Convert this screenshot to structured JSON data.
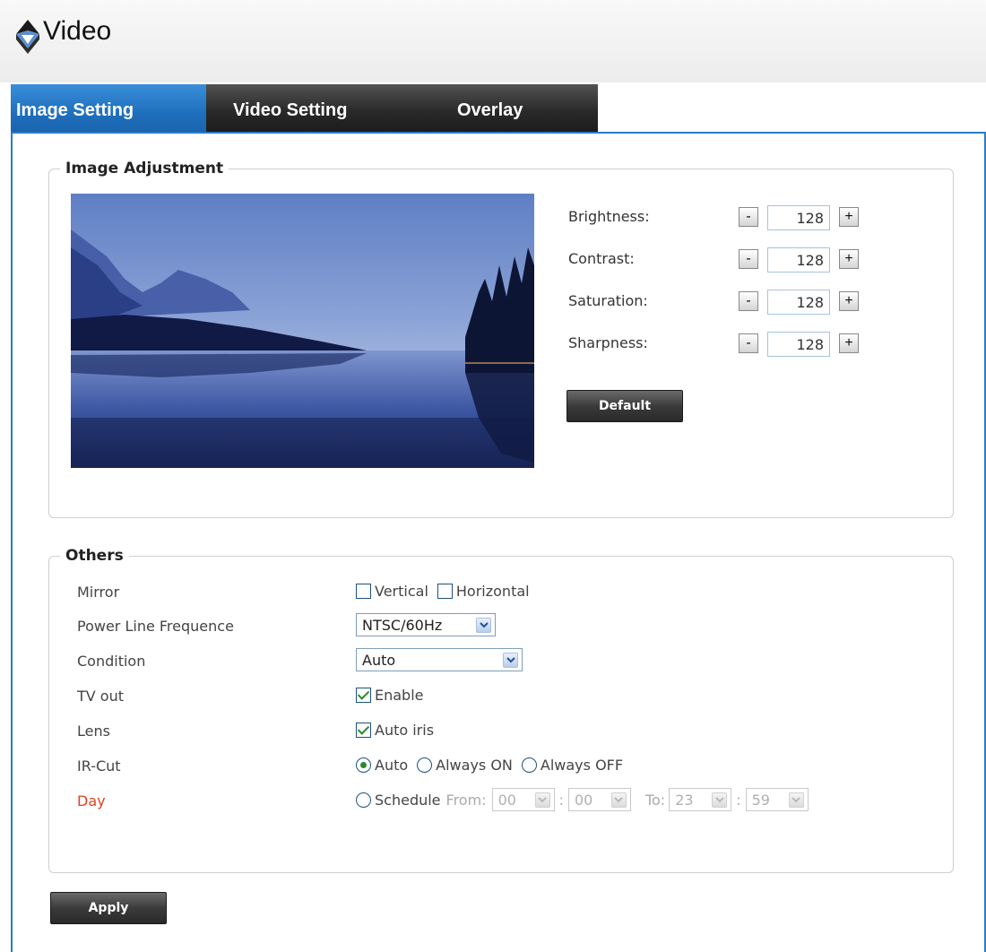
{
  "header": {
    "title": "Video"
  },
  "tabs": [
    {
      "label": "Image Setting",
      "active": true
    },
    {
      "label": "Video Setting",
      "active": false
    },
    {
      "label": "Overlay",
      "active": false
    }
  ],
  "image_adjustment": {
    "legend": "Image Adjustment",
    "rows": [
      {
        "label": "Brightness:",
        "value": "128"
      },
      {
        "label": "Contrast:",
        "value": "128"
      },
      {
        "label": "Saturation:",
        "value": "128"
      },
      {
        "label": "Sharpness:",
        "value": "128"
      }
    ],
    "minus_symbol": "-",
    "plus_symbol": "+",
    "default_label": "Default"
  },
  "others": {
    "legend": "Others",
    "mirror": {
      "label": "Mirror",
      "vertical": "Vertical",
      "horizontal": "Horizontal",
      "vertical_checked": false,
      "horizontal_checked": false
    },
    "power_line": {
      "label": "Power Line Frequence",
      "value": "NTSC/60Hz"
    },
    "condition": {
      "label": "Condition",
      "value": "Auto"
    },
    "tv_out": {
      "label": "TV out",
      "option": "Enable",
      "checked": true
    },
    "lens": {
      "label": "Lens",
      "option": "Auto iris",
      "checked": true
    },
    "ir_cut": {
      "label": "IR-Cut",
      "options": [
        "Auto",
        "Always ON",
        "Always OFF"
      ],
      "selected": "Auto"
    },
    "day": {
      "label": "Day",
      "schedule_label": "Schedule",
      "from_label": "From:",
      "to_label": "To:",
      "colon": ":",
      "from_hour": "00",
      "from_min": "00",
      "to_hour": "23",
      "to_min": "59"
    }
  },
  "apply_label": "Apply",
  "colors": {
    "accent": "#2b7bc8",
    "tab_active": "#1f6fbd",
    "tab_inactive": "#2a2a2a",
    "day_label": "#e04020",
    "check": "#2b8a2b"
  }
}
